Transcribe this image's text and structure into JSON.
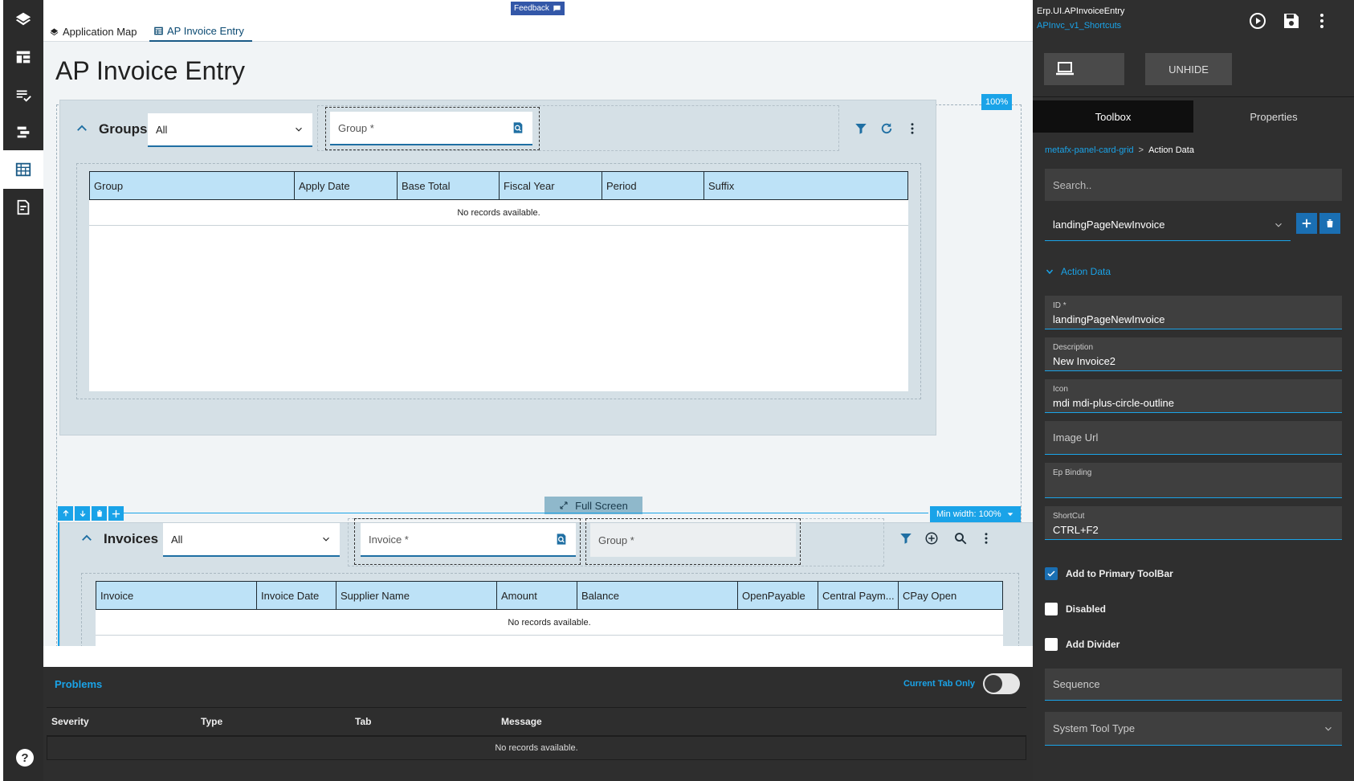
{
  "nav": {
    "items": [
      "layers-icon",
      "dashboard-icon",
      "checklist-icon",
      "sync-icon",
      "table-icon",
      "edit-doc-icon"
    ],
    "active_index": 4
  },
  "tabs": [
    {
      "label": "Application Map",
      "icon": "layers-icon"
    },
    {
      "label": "AP Invoice Entry",
      "icon": "grid-icon",
      "active": true
    }
  ],
  "feedback": {
    "label": "Feedback"
  },
  "page": {
    "title": "AP Invoice Entry",
    "zoom_badge": "100%"
  },
  "groups_panel": {
    "title": "Groups",
    "filter_value": "All",
    "search_field_placeholder": "Group *",
    "columns": [
      "Group",
      "Apply Date",
      "Base Total",
      "Fiscal Year",
      "Period",
      "Suffix"
    ],
    "empty_text": "No records available.",
    "full_screen_label": "Full Screen"
  },
  "invoices_panel": {
    "title": "Invoices",
    "filter_value": "All",
    "invoice_field_placeholder": "Invoice *",
    "group_field_placeholder": "Group *",
    "min_width_label": "Min width: 100%",
    "columns": [
      "Invoice",
      "Invoice Date",
      "Supplier Name",
      "Amount",
      "Balance",
      "OpenPayable",
      "Central Paym...",
      "CPay Open"
    ],
    "empty_text": "No records available."
  },
  "problems": {
    "title": "Problems",
    "current_tab_only_label": "Current Tab Only",
    "current_tab_only": false,
    "columns": [
      "Severity",
      "Type",
      "Tab",
      "Message"
    ],
    "empty_text": "No records available."
  },
  "right_panel": {
    "title": "Erp.UI.APInvoiceEntry",
    "subtitle": "APInvc_v1_Shortcuts",
    "unhide_label": "UNHIDE",
    "tabs": [
      "Toolbox",
      "Properties"
    ],
    "active_tab": "Toolbox",
    "breadcrumb": [
      "metafx-panel-card-grid",
      "Action Data"
    ],
    "search_placeholder": "Search..",
    "action_select_value": "landingPageNewInvoice",
    "section_title": "Action Data",
    "fields": {
      "id": {
        "label": "ID *",
        "value": "landingPageNewInvoice"
      },
      "description": {
        "label": "Description",
        "value": "New Invoice2"
      },
      "icon": {
        "label": "Icon",
        "value": "mdi mdi-plus-circle-outline"
      },
      "image_url": {
        "placeholder": "Image Url"
      },
      "ep_binding": {
        "label": "Ep Binding",
        "value": ""
      },
      "shortcut": {
        "label": "ShortCut",
        "value": "CTRL+F2"
      },
      "sequence": {
        "placeholder": "Sequence"
      },
      "system_tool_type": {
        "placeholder": "System Tool Type"
      }
    },
    "checkboxes": {
      "add_to_primary_toolbar": {
        "label": "Add to Primary ToolBar",
        "checked": true
      },
      "disabled": {
        "label": "Disabled",
        "checked": false
      },
      "add_divider": {
        "label": "Add Divider",
        "checked": false
      }
    }
  },
  "help": {
    "label": "?"
  },
  "colors": {
    "accent": "#1aa3e8",
    "grid_header": "#bde2f7",
    "nav_bg": "#2b2b2b",
    "right_panel_bg": "#2f2f2f"
  }
}
